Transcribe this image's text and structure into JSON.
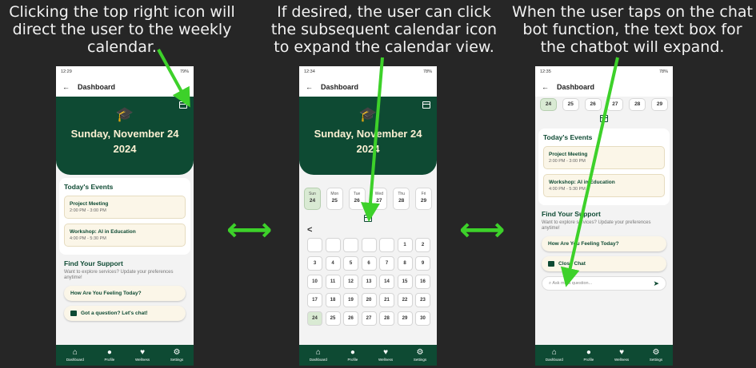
{
  "captions": {
    "left": [
      "Clicking the top right icon will",
      "direct the user to the weekly",
      "calendar."
    ],
    "middle": [
      "If desired, the user can click",
      "the subsequent calendar icon",
      "to expand the calendar view."
    ],
    "right": [
      "When the user taps on the chat",
      "bot function, the text box for",
      "the chatbot will expand."
    ]
  },
  "phone1": {
    "status_time": "12:29",
    "status_right": "79%",
    "app_title": "Dashboard",
    "date_line1": "Sunday, November 24",
    "date_line2": "2024",
    "events_title": "Today's Events",
    "events": [
      {
        "title": "Project Meeting",
        "time": "2:00 PM - 3:00 PM"
      },
      {
        "title": "Workshop: AI in Education",
        "time": "4:00 PM - 5:30 PM"
      }
    ],
    "support_title": "Find Your Support",
    "support_sub": "Want to explore services? Update your preferences anytime!",
    "pill1": "How Are You Feeling Today?",
    "pill2": "Got a question? Let's chat!"
  },
  "phone2": {
    "status_time": "12:34",
    "status_right": "78%",
    "app_title": "Dashboard",
    "date_line1": "Sunday, November 24",
    "date_line2": "2024",
    "week": [
      {
        "d": "Sun",
        "n": "24"
      },
      {
        "d": "Mon",
        "n": "25"
      },
      {
        "d": "Tue",
        "n": "26"
      },
      {
        "d": "Wed",
        "n": "27"
      },
      {
        "d": "Thu",
        "n": "28"
      },
      {
        "d": "Fri",
        "n": "29"
      }
    ],
    "back_chevron": "<",
    "month_cells": [
      "",
      "",
      "",
      "",
      "",
      "1",
      "2",
      "3",
      "4",
      "5",
      "6",
      "7",
      "8",
      "9",
      "10",
      "11",
      "12",
      "13",
      "14",
      "15",
      "16",
      "17",
      "18",
      "19",
      "20",
      "21",
      "22",
      "23",
      "24",
      "25",
      "26",
      "27",
      "28",
      "29",
      "30"
    ]
  },
  "phone3": {
    "status_time": "12:35",
    "status_right": "78%",
    "app_title": "Dashboard",
    "week_nums": [
      "24",
      "25",
      "26",
      "27",
      "28",
      "29"
    ],
    "events_title": "Today's Events",
    "events": [
      {
        "title": "Project Meeting",
        "time": "2:00 PM - 3:00 PM"
      },
      {
        "title": "Workshop: AI in Education",
        "time": "4:00 PM - 5:30 PM"
      }
    ],
    "support_title": "Find Your Support",
    "support_sub": "Want to explore services? Update your preferences anytime!",
    "pill1": "How Are You Feeling Today?",
    "pill2": "Close Chat",
    "input_placeholder": "Ask me a question..."
  },
  "nav": [
    {
      "label": "Dashboard",
      "icon": "home-icon"
    },
    {
      "label": "Profile",
      "icon": "person-icon"
    },
    {
      "label": "Wellness",
      "icon": "heart-icon"
    },
    {
      "label": "Settings",
      "icon": "gear-icon"
    }
  ],
  "colors": {
    "brand": "#0e4a33",
    "arrow": "#3dd12a",
    "cream": "#fbf6e8"
  }
}
